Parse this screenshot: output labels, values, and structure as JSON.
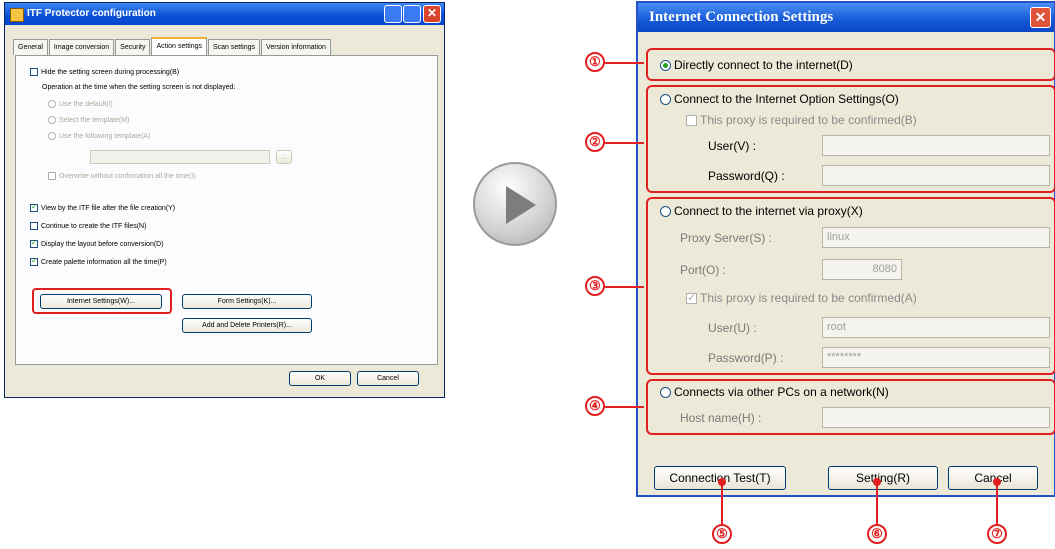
{
  "left_window": {
    "title": "ITF Protector configuration",
    "tabs": [
      "General",
      "Image conversion",
      "Security",
      "Action settings",
      "Scan settings",
      "Version information"
    ],
    "hide_screen": "Hide the setting screen during processing(B)",
    "operation_label": "Operation at the time when the setting screen is not displayed:",
    "opt_default": "Use the default(I)",
    "opt_select_template": "Select the template(M)",
    "opt_use_template": "Use the following template(A)",
    "browse": "...",
    "overwrite": "Overwrite without confirmation all the time(I)",
    "view_itf": "View by the ITF file after the file creation(Y)",
    "continue_create": "Continue to create the ITF files(N)",
    "display_layout": "Display the layout before conversion(D)",
    "create_palette": "Create palette information all the time(P)",
    "internet_settings": "Internet Settings(W)...",
    "form_settings": "Form Settings(K)...",
    "add_delete_printers": "Add and Delete Printers(R)...",
    "ok": "OK",
    "cancel": "Cancel"
  },
  "right_window": {
    "title": "Internet Connection Settings",
    "direct": "Directly connect to the internet(D)",
    "option_settings": "Connect to the Internet Option Settings(O)",
    "proxy_confirm_b": "This proxy is required to be confirmed(B)",
    "user_v": "User(V) :",
    "password_q": "Password(Q) :",
    "via_proxy": "Connect to the internet via proxy(X)",
    "proxy_server": "Proxy Server(S) :",
    "proxy_server_value": "linux",
    "port": "Port(O) :",
    "port_value": "8080",
    "proxy_confirm_a": "This proxy is required to be confirmed(A)",
    "user_u": "User(U) :",
    "user_u_value": "root",
    "password_p": "Password(P) :",
    "password_p_value": "********",
    "other_pcs": "Connects via other PCs on a network(N)",
    "host_name": "Host name(H) :",
    "connection_test": "Connection Test(T)",
    "setting": "Setting(R)",
    "cancel": "Cancel"
  },
  "callouts": [
    "①",
    "②",
    "③",
    "④",
    "⑤",
    "⑥",
    "⑦"
  ]
}
